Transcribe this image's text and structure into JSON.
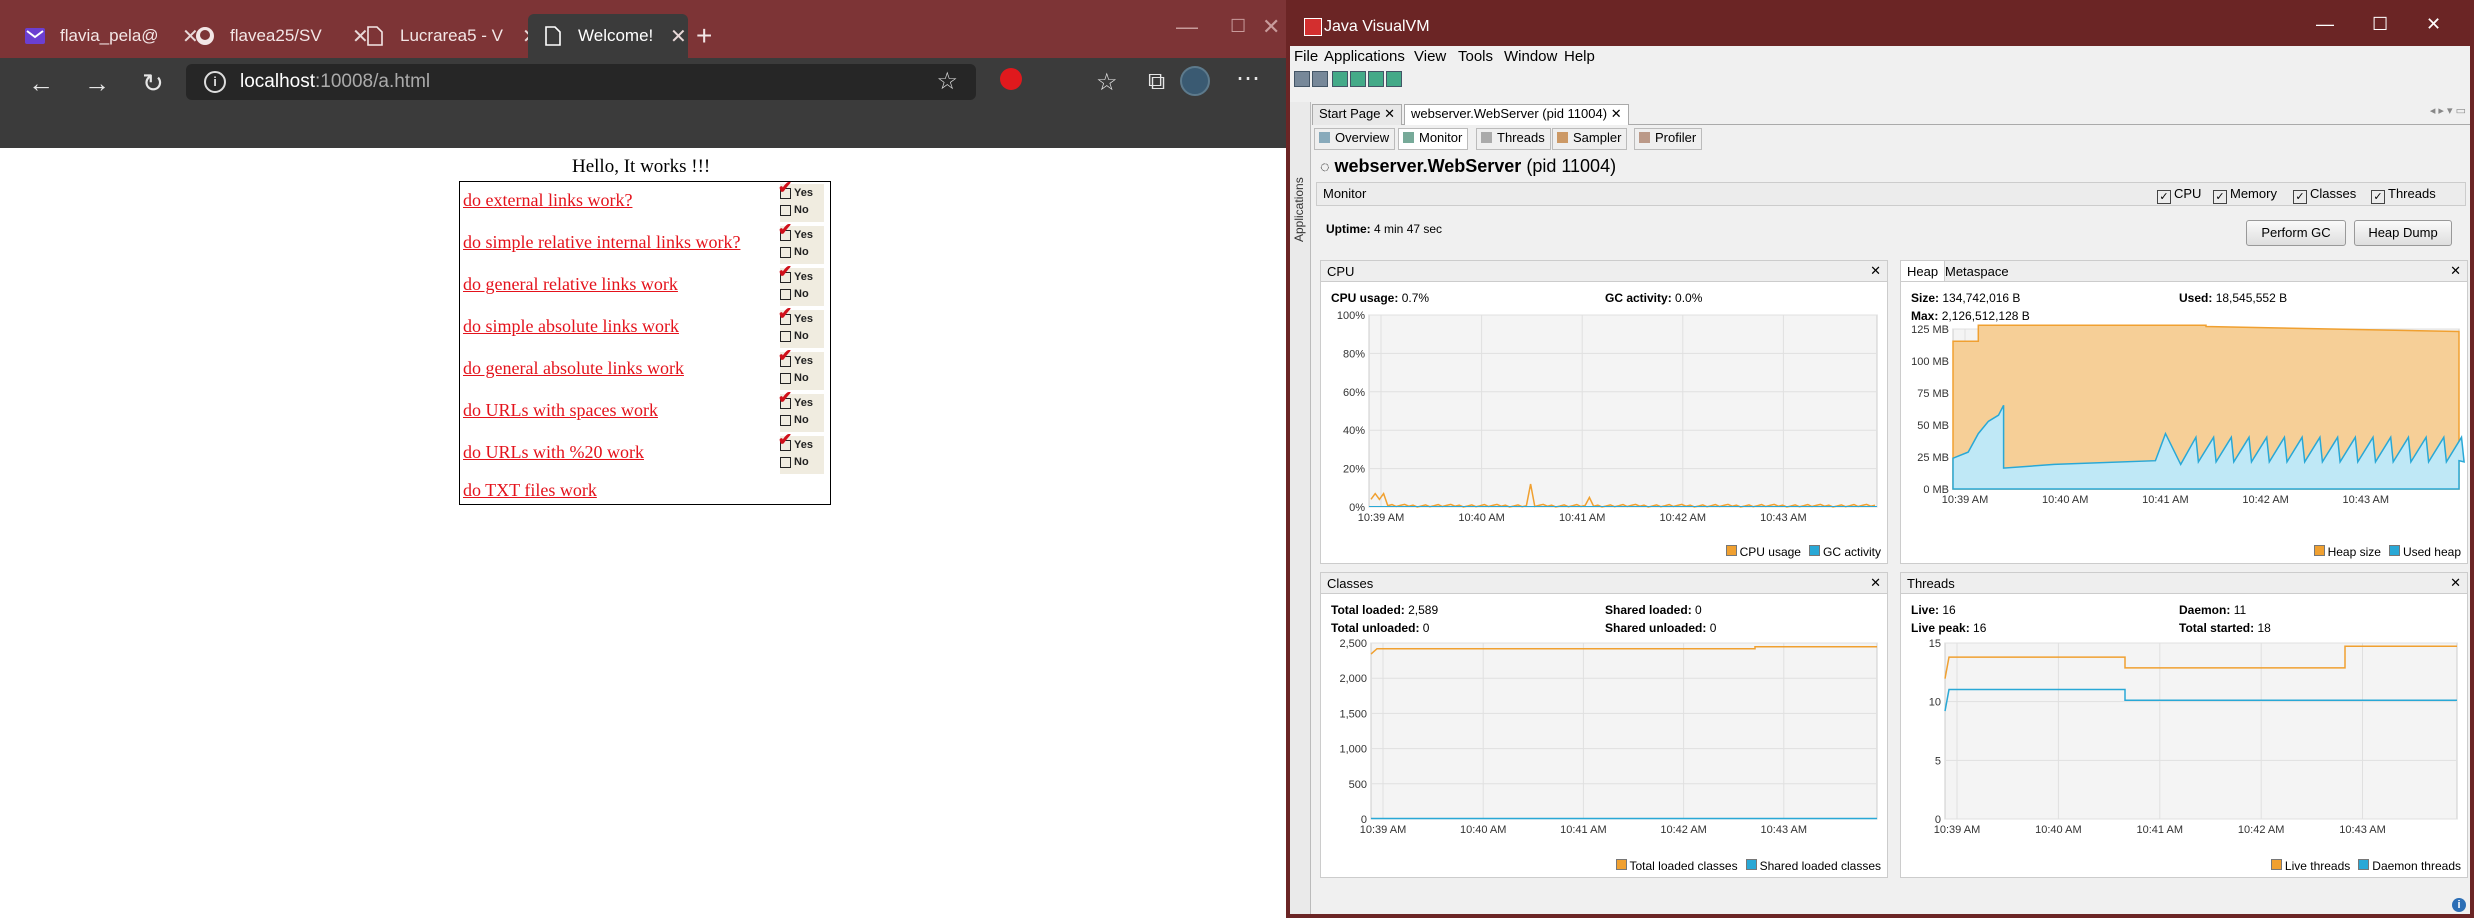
{
  "browser": {
    "tabs": [
      {
        "label": "flavia_pela@",
        "icon": "yahoo-mail-icon"
      },
      {
        "label": "flavea25/SV",
        "icon": "github-icon"
      },
      {
        "label": "Lucrarea5 - V",
        "icon": "page-icon"
      },
      {
        "label": "Welcome!",
        "icon": "page-icon",
        "active": true
      }
    ],
    "address": {
      "host": "localhost",
      "rest": ":10008/a.html"
    },
    "page": {
      "hello": "Hello, It works !!!",
      "links": [
        "do external links work?",
        "do simple relative internal links work?",
        "do general relative links work",
        "do simple absolute links work",
        "do general absolute links work",
        "do URLs with spaces work",
        "do URLs with %20 work",
        "do TXT files work"
      ],
      "yes": "Yes",
      "no": "No"
    }
  },
  "vvm": {
    "title": "Java VisualVM",
    "menu": [
      "File",
      "Applications",
      "View",
      "Tools",
      "Window",
      "Help"
    ],
    "side_label": "Applications",
    "doc_tabs": [
      "Start Page",
      "webserver.WebServer (pid 11004)"
    ],
    "sub_tabs": [
      "Overview",
      "Monitor",
      "Threads",
      "Sampler",
      "Profiler"
    ],
    "app_name": "webserver.WebServer",
    "app_pid": "(pid 11004)",
    "monitor_label": "Monitor",
    "checks": [
      "CPU",
      "Memory",
      "Classes",
      "Threads"
    ],
    "uptime_label": "Uptime:",
    "uptime_value": "4 min 47 sec",
    "buttons": {
      "gc": "Perform GC",
      "heap_dump": "Heap Dump"
    },
    "cpu": {
      "title": "CPU",
      "usage_label": "CPU usage:",
      "usage": "0.7%",
      "gc_label": "GC activity:",
      "gc": "0.0%",
      "yticks": [
        "100%",
        "80%",
        "60%",
        "40%",
        "20%",
        "0%"
      ],
      "xticks": [
        "10:39 AM",
        "10:40 AM",
        "10:41 AM",
        "10:42 AM",
        "10:43 AM"
      ],
      "legend": [
        "CPU usage",
        "GC activity"
      ]
    },
    "heap": {
      "tabs": [
        "Heap",
        "Metaspace"
      ],
      "size_label": "Size:",
      "size": "134,742,016 B",
      "used_label": "Used:",
      "used": "18,545,552 B",
      "max_label": "Max:",
      "max": "2,126,512,128 B",
      "yticks": [
        "125 MB",
        "100 MB",
        "75 MB",
        "50 MB",
        "25 MB",
        "0 MB"
      ],
      "xticks": [
        "10:39 AM",
        "10:40 AM",
        "10:41 AM",
        "10:42 AM",
        "10:43 AM"
      ],
      "legend": [
        "Heap size",
        "Used heap"
      ]
    },
    "classes": {
      "title": "Classes",
      "total_loaded_label": "Total loaded:",
      "total_loaded": "2,589",
      "total_unloaded_label": "Total unloaded:",
      "total_unloaded": "0",
      "shared_loaded_label": "Shared loaded:",
      "shared_loaded": "0",
      "shared_unloaded_label": "Shared unloaded:",
      "shared_unloaded": "0",
      "yticks": [
        "2,500",
        "2,000",
        "1,500",
        "1,000",
        "500",
        "0"
      ],
      "xticks": [
        "10:39 AM",
        "10:40 AM",
        "10:41 AM",
        "10:42 AM",
        "10:43 AM"
      ],
      "legend": [
        "Total loaded classes",
        "Shared loaded classes"
      ]
    },
    "threads": {
      "title": "Threads",
      "live_label": "Live:",
      "live": "16",
      "peak_label": "Live peak:",
      "peak": "16",
      "daemon_label": "Daemon:",
      "daemon": "11",
      "started_label": "Total started:",
      "started": "18",
      "yticks": [
        "15",
        "10",
        "5",
        "0"
      ],
      "xticks": [
        "10:39 AM",
        "10:40 AM",
        "10:41 AM",
        "10:42 AM",
        "10:43 AM"
      ],
      "legend": [
        "Live threads",
        "Daemon threads"
      ]
    },
    "colors": {
      "orange": "#f0a030",
      "blue": "#29a8d6",
      "heapfill": "#f6cf97",
      "usedfill": "#bfe8f6"
    }
  }
}
